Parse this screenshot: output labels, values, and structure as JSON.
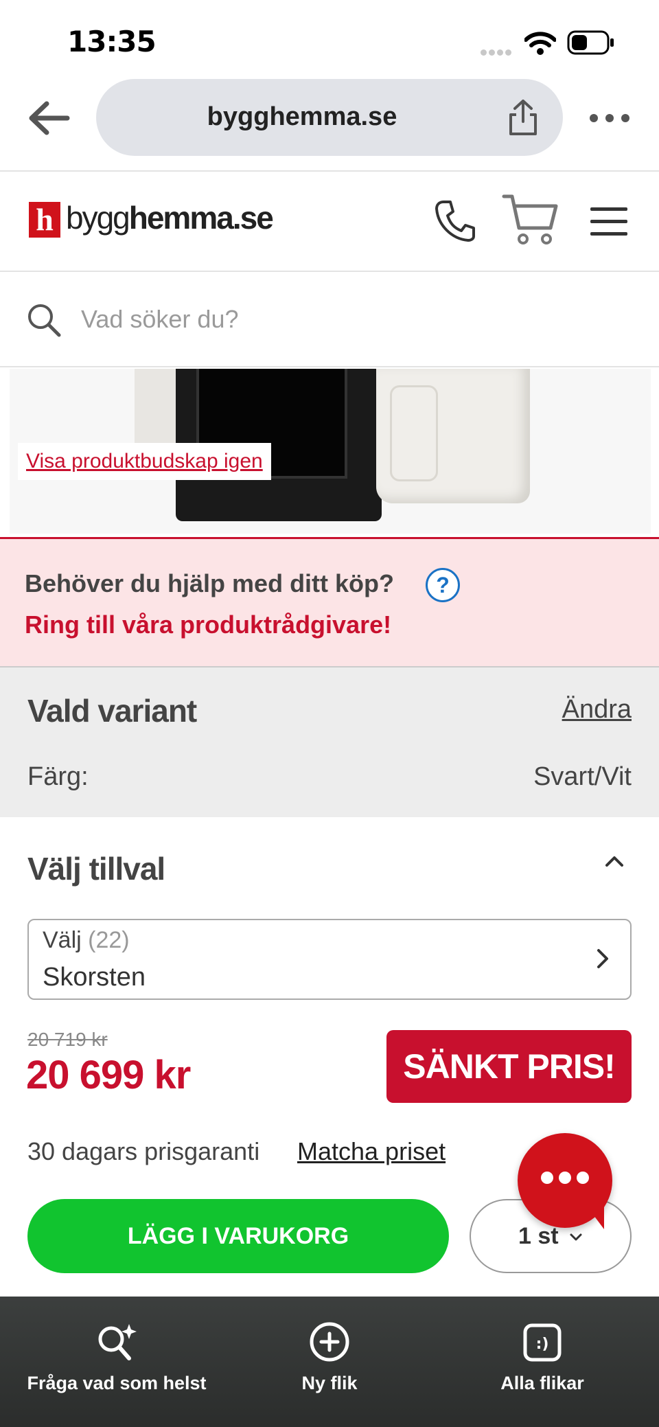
{
  "status_bar": {
    "time": "13:35"
  },
  "browser": {
    "url": "bygghemma.se"
  },
  "site": {
    "logo_letter": "h",
    "logo_bygg": "bygg",
    "logo_hemma": "hemma",
    "logo_se": ".se",
    "search_placeholder": "Vad söker du?"
  },
  "product": {
    "show_messages_link": "Visa produktbudskap igen"
  },
  "help": {
    "question": "Behöver du hjälp med ditt köp?",
    "help_icon_glyph": "?",
    "cta": "Ring till våra produktrådgivare!"
  },
  "variant": {
    "title": "Vald variant",
    "change_label": "Ändra",
    "color_label": "Färg:",
    "color_value": "Svart/Vit"
  },
  "addons": {
    "title": "Välj tillval",
    "select_label": "Välj",
    "select_count": "(22)",
    "select_value": "Skorsten"
  },
  "pricing": {
    "old_price": "20 719 kr",
    "price": "20 699 kr",
    "badge": "SÄNKT PRIS!",
    "guarantee": "30 dagars prisgaranti",
    "match_price": "Matcha priset"
  },
  "cart": {
    "add_label": "LÄGG I VARUKORG",
    "quantity": "1 st"
  },
  "toolbar": {
    "ask_label": "Fråga vad som helst",
    "new_tab_label": "Ny flik",
    "all_tabs_label": "Alla flikar"
  },
  "colors": {
    "brand_red": "#c8102e",
    "cart_green": "#11c42f",
    "help_bg": "#fce4e6",
    "variant_bg": "#ededed"
  },
  "icons": [
    "back-arrow-icon",
    "share-icon",
    "more-icon",
    "phone-icon",
    "cart-icon",
    "hamburger-menu-icon",
    "search-icon",
    "help-icon",
    "chevron-up-icon",
    "chevron-right-icon",
    "chevron-down-icon",
    "chat-icon",
    "ai-search-icon",
    "new-tab-icon",
    "all-tabs-icon",
    "wifi-icon",
    "battery-icon"
  ]
}
